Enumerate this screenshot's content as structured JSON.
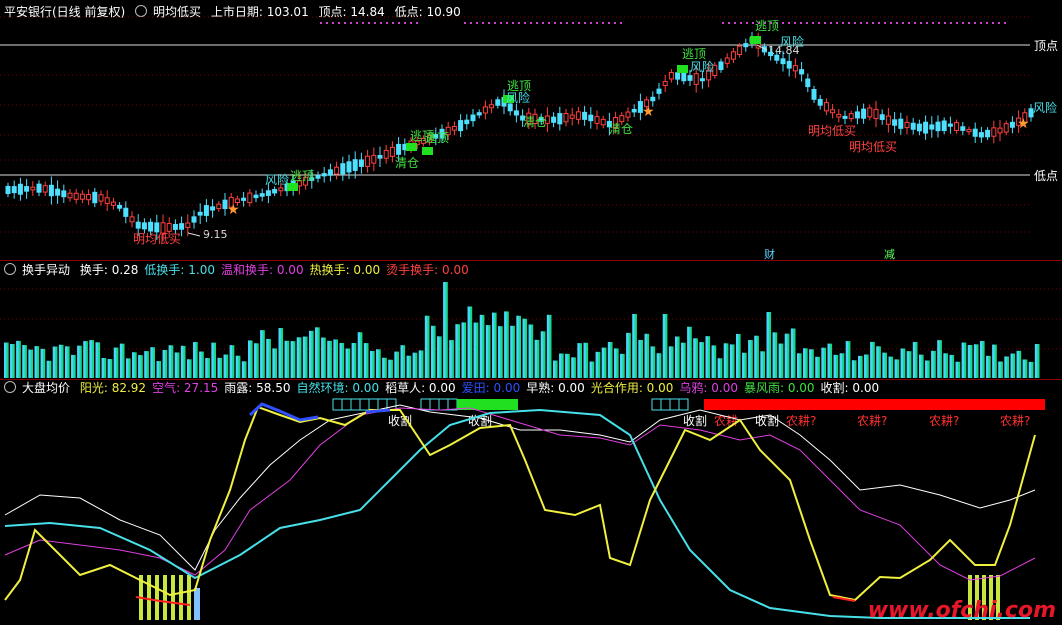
{
  "main": {
    "stock": "平安银行(日线 前复权)",
    "indicator": "明均低买",
    "ipo_label": "上市日期: 103.01",
    "top_label": "顶点: 14.84",
    "low_label": "低点: 10.90",
    "right_top": "顶点",
    "right_low": "低点",
    "price_low_tag": "9.15",
    "price_high_tag": "14.84",
    "badge_cai": "财",
    "badge_jian": "减",
    "labels": {
      "escape": "逃顶",
      "risk": "风险",
      "clear": "清仓",
      "buy": "明均低买"
    }
  },
  "turnover": {
    "title": "换手异动",
    "items": [
      {
        "text": "换手: 0.28",
        "color": "#ffffff"
      },
      {
        "text": "低换手: 1.00",
        "color": "#47e0e8"
      },
      {
        "text": "温和换手: 0.00",
        "color": "#e040e0"
      },
      {
        "text": "热换手: 0.00",
        "color": "#f0f040"
      },
      {
        "text": "烫手换手: 0.00",
        "color": "#ff4040"
      }
    ]
  },
  "market": {
    "title": "大盘均价",
    "items": [
      {
        "text": "阳光: 82.92",
        "color": "#f0f040"
      },
      {
        "text": "空气: 27.15",
        "color": "#e040e0"
      },
      {
        "text": "雨露: 58.50",
        "color": "#ffffff"
      },
      {
        "text": "自然环境: 0.00",
        "color": "#47e0e8"
      },
      {
        "text": "稻草人: 0.00",
        "color": "#ffffff"
      },
      {
        "text": "爱田: 0.00",
        "color": "#3050ff"
      },
      {
        "text": "早熟: 0.00",
        "color": "#ffffff"
      },
      {
        "text": "光合作用: 0.00",
        "color": "#f0f040"
      },
      {
        "text": "乌鸦: 0.00",
        "color": "#e040e0"
      },
      {
        "text": "暴风雨: 0.00",
        "color": "#40e040"
      },
      {
        "text": "收割: 0.00",
        "color": "#ffffff"
      }
    ],
    "harvest": "收割",
    "farm": "农耕",
    "farm_q": "农耕?"
  },
  "watermark": "www.ofchi.com"
}
